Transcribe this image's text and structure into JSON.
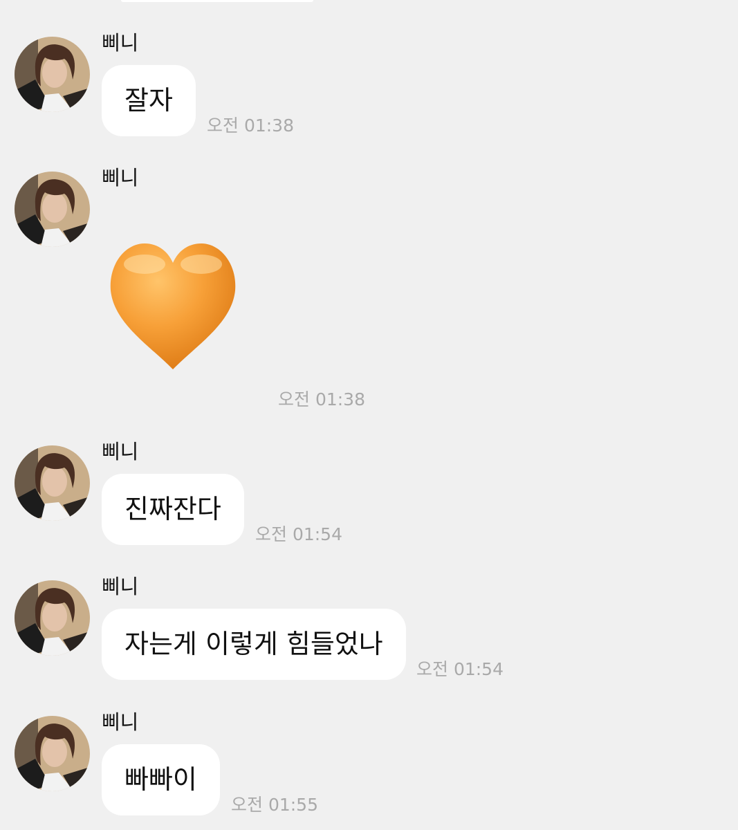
{
  "chat": {
    "messages": [
      {
        "sender": "삐니",
        "text": "잘자",
        "time": "오전 01:38"
      },
      {
        "sender": "삐니",
        "emoji": "orange-heart",
        "time": "오전 01:38"
      },
      {
        "sender": "삐니",
        "text": "진짜잔다",
        "time": "오전 01:54"
      },
      {
        "sender": "삐니",
        "text": "자는게 이렇게 힘들었나",
        "time": "오전 01:54"
      },
      {
        "sender": "삐니",
        "text": "빠빠이",
        "time": "오전 01:55"
      }
    ]
  },
  "colors": {
    "background": "#f0f0f0",
    "bubble": "#ffffff",
    "text": "#111111",
    "timestamp": "#a9a9a9",
    "heart": "#f39a2c"
  }
}
